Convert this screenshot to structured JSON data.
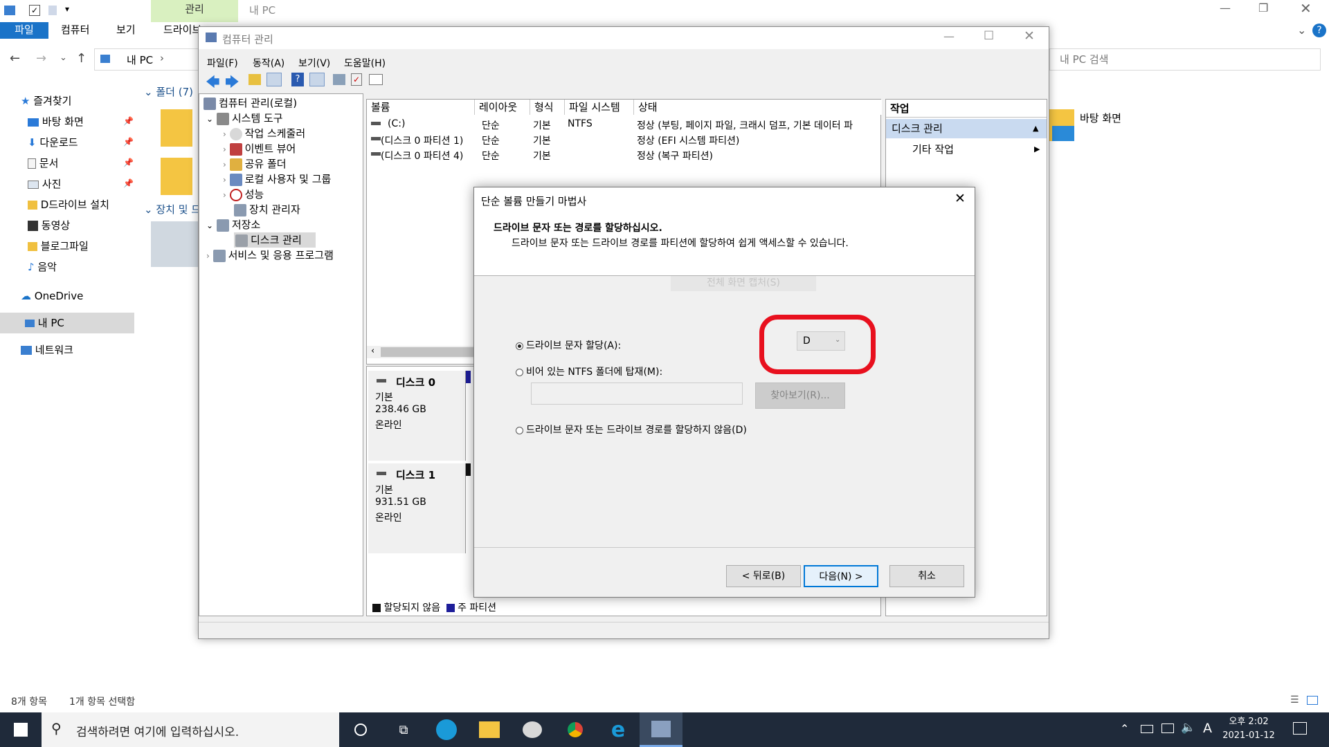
{
  "explorer": {
    "ribbon_tabs": [
      "파일",
      "컴퓨터",
      "보기",
      "드라이브"
    ],
    "context_tab": "관리",
    "title": "내 PC",
    "address": "내 PC",
    "search_placeholder": "내 PC 검색",
    "nav": {
      "favorites": "즐겨찾기",
      "items": [
        "바탕 화면",
        "다운로드",
        "문서",
        "사진",
        "D드라이브 설치",
        "동영상",
        "블로그파일",
        "음악"
      ],
      "onedrive": "OneDrive",
      "thispc": "내 PC",
      "network": "네트워크"
    },
    "folders_header": "폴더 (7)",
    "devices_header": "장치 및 드",
    "right_folder": "바탕 화면",
    "status_items": "8개 항목",
    "status_selected": "1개 항목 선택함"
  },
  "cm": {
    "title": "컴퓨터 관리",
    "menu": [
      "파일(F)",
      "동작(A)",
      "보기(V)",
      "도움말(H)"
    ],
    "tree": {
      "root": "컴퓨터 관리(로컬)",
      "system_tools": "시스템 도구",
      "task_scheduler": "작업 스케줄러",
      "event_viewer": "이벤트 뷰어",
      "shared_folders": "공유 폴더",
      "local_users": "로컬 사용자 및 그룹",
      "performance": "성능",
      "device_manager": "장치 관리자",
      "storage": "저장소",
      "disk_management": "디스크 관리",
      "services": "서비스 및 응용 프로그램"
    },
    "columns": [
      "볼륨",
      "레이아웃",
      "형식",
      "파일 시스템",
      "상태"
    ],
    "volumes": [
      {
        "name": "(C:)",
        "layout": "단순",
        "type": "기본",
        "fs": "NTFS",
        "status": "정상 (부팅, 페이지 파일, 크래시 덤프, 기본 데이터 파"
      },
      {
        "name": "(디스크 0 파티션 1)",
        "layout": "단순",
        "type": "기본",
        "fs": "",
        "status": "정상 (EFI 시스템 파티션)"
      },
      {
        "name": "(디스크 0 파티션 4)",
        "layout": "단순",
        "type": "기본",
        "fs": "",
        "status": "정상 (복구 파티션)"
      }
    ],
    "disks": [
      {
        "name": "디스크 0",
        "type": "기본",
        "size": "238.46 GB",
        "state": "온라인"
      },
      {
        "name": "디스크 1",
        "type": "기본",
        "size": "931.51 GB",
        "state": "온라인"
      }
    ],
    "legend": [
      "할당되지 않음",
      "주 파티션"
    ],
    "actions": {
      "header": "작업",
      "disk_management": "디스크 관리",
      "more_actions": "기타 작업"
    }
  },
  "wizard": {
    "title": "단순 볼륨 만들기 마법사",
    "heading": "드라이브 문자 또는 경로를 할당하십시오.",
    "description": "드라이브 문자 또는 드라이브 경로를 파티션에 할당하여 쉽게 액세스할 수 있습니다.",
    "faded_text": "전체 화면 캡처(S)",
    "option_assign_letter": "드라이브 문자 할당(A):",
    "drive_letter": "D",
    "option_mount_folder": "비어 있는 NTFS 폴더에 탑재(M):",
    "browse": "찾아보기(R)...",
    "option_none": "드라이브 문자 또는 드라이브 경로를 할당하지 않음(D)",
    "back": "< 뒤로(B)",
    "next": "다음(N) >",
    "cancel": "취소",
    "highlight_color": "#e8101e"
  },
  "taskbar": {
    "search_placeholder": "검색하려면 여기에 입력하십시오.",
    "time": "오후 2:02",
    "date": "2021-01-12",
    "ime": "A"
  }
}
